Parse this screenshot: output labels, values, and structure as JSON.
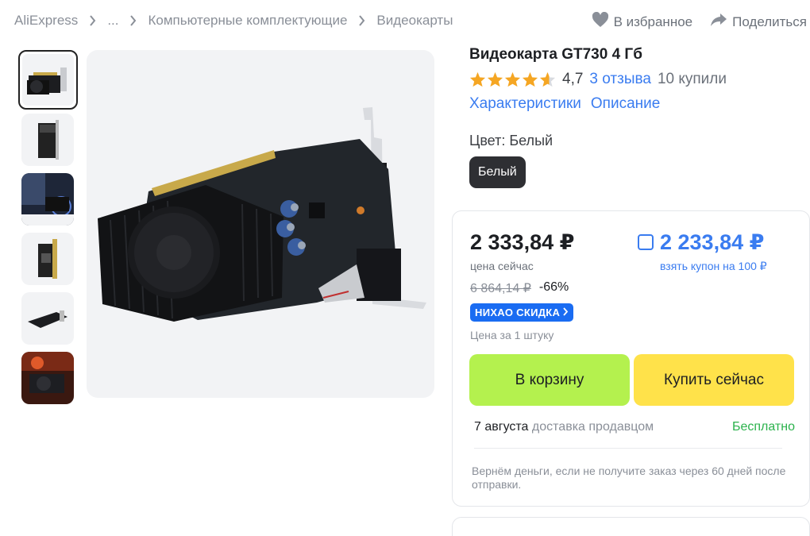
{
  "breadcrumb": [
    "AliExpress",
    "...",
    "Компьютерные комплектующие",
    "Видеокарты"
  ],
  "actions": {
    "favorite": "В избранное",
    "share": "Поделиться"
  },
  "product": {
    "title": "Видеокарта GT730 4 Гб",
    "rating": "4,7",
    "rating_value": 4.7,
    "reviews": "3 отзыва",
    "bought": "10 купили",
    "tabs": [
      "Характеристики",
      "Описание"
    ],
    "color_label": "Цвет: Белый",
    "color_option": "Белый"
  },
  "thumbnails": [
    "graphics-card-front",
    "graphics-card-back",
    "graphics-card-installed",
    "graphics-card-side",
    "graphics-card-angle",
    "graphics-card-box"
  ],
  "price": {
    "current": "2 333,84 ₽",
    "current_label": "цена сейчас",
    "coupon_price": "2 233,84 ₽",
    "coupon_label": "взять купон на 100 ₽",
    "old": "6 864,14 ₽",
    "discount": "-66%",
    "badge": "НИХАО СКИДКА",
    "per_unit": "Цена за 1 штуку"
  },
  "buttons": {
    "cart": "В корзину",
    "buy": "Купить сейчас"
  },
  "delivery": {
    "date": "7 августа",
    "by": "доставка продавцом",
    "cost": "Бесплатно"
  },
  "guarantee": "Вернём деньги, если не получите заказ через 60 дней после отправки.",
  "colors": {
    "link": "#3a7cf0",
    "star": "#f5a623",
    "cart": "#b4f14e",
    "buy": "#ffe24a",
    "free": "#2bb24c",
    "badge": "#1a6cf2"
  }
}
